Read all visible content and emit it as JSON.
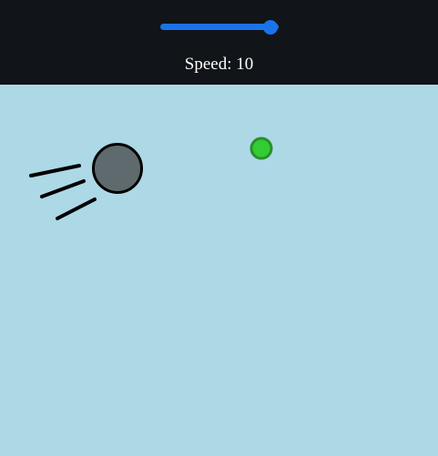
{
  "controls": {
    "speed_slider": {
      "min": 0,
      "max": 10,
      "value": 10,
      "accent_color": "#1a73e8"
    },
    "speed_label": "Speed: 10"
  },
  "scene": {
    "background_color": "#add8e6",
    "ball": {
      "fill": "#5f6a6e",
      "stroke": "#000000"
    },
    "target_dot": {
      "fill": "#33cc33",
      "stroke": "#2a8f2a"
    }
  }
}
